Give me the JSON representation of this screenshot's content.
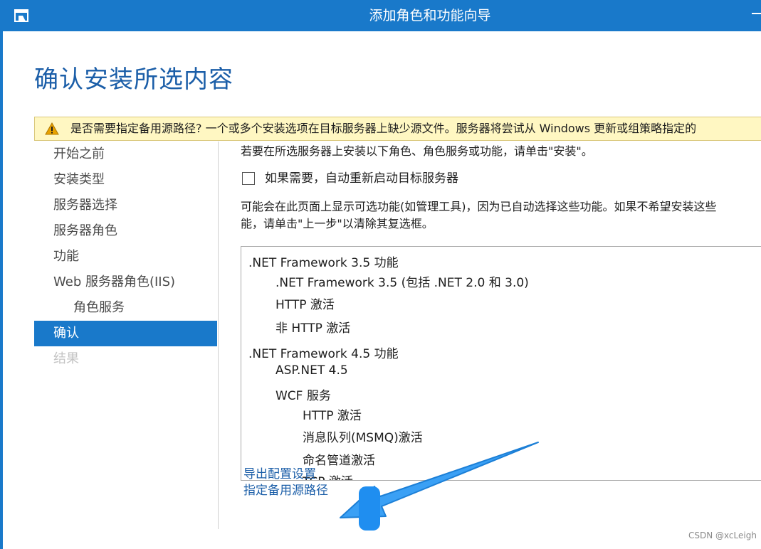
{
  "window": {
    "title": "添加角色和功能向导",
    "minimize_glyph": ""
  },
  "page": {
    "title": "确认安装所选内容"
  },
  "warning": {
    "text": "是否需要指定备用源路径? 一个或多个安装选项在目标服务器上缺少源文件。服务器将尝试从 Windows 更新或组策略指定的"
  },
  "nav": {
    "items": [
      {
        "label": "开始之前"
      },
      {
        "label": "安装类型"
      },
      {
        "label": "服务器选择"
      },
      {
        "label": "服务器角色"
      },
      {
        "label": "功能"
      },
      {
        "label": "Web 服务器角色(IIS)"
      },
      {
        "label": "角色服务"
      },
      {
        "label": "确认"
      },
      {
        "label": "结果"
      }
    ]
  },
  "main": {
    "intro": "若要在所选服务器上安装以下角色、角色服务或功能，请单击\"安装\"。",
    "restart_checkbox_label": "如果需要，自动重新启动目标服务器",
    "note_line1": "可能会在此页面上显示可选功能(如管理工具)，因为已自动选择这些功能。如果不希望安装这些",
    "note_line2": "能，请单击\"上一步\"以清除其复选框。",
    "features": [
      {
        "label": ".NET Framework 3.5 功能"
      },
      {
        "label": ".NET Framework 3.5 (包括 .NET 2.0 和 3.0)"
      },
      {
        "label": "HTTP 激活"
      },
      {
        "label": "非 HTTP 激活"
      },
      {
        "label": ".NET Framework 4.5 功能"
      },
      {
        "label": "ASP.NET 4.5"
      },
      {
        "label": "WCF 服务"
      },
      {
        "label": "HTTP 激活"
      },
      {
        "label": "消息队列(MSMQ)激活"
      },
      {
        "label": "命名管道激活"
      },
      {
        "label": "TCP 激活"
      }
    ],
    "links": {
      "export": "导出配置设置",
      "alt_source": "指定备用源路径"
    }
  },
  "watermark": "CSDN @xcLeigh",
  "colors": {
    "accent": "#1979ca",
    "title": "#1b5ea8",
    "warning_bg": "#fff7c2"
  }
}
